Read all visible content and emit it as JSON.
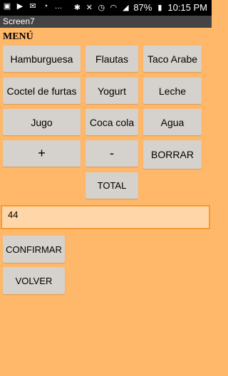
{
  "statusbar": {
    "battery": "87%",
    "time": "10:15 PM"
  },
  "app": {
    "title": "Screen7",
    "menu_label": "MENÚ"
  },
  "buttons": {
    "hamburguesa": "Hamburguesa",
    "flautas": "Flautas",
    "taco_arabe": "Taco Arabe",
    "coctel": "Coctel de furtas",
    "yogurt": "Yogurt",
    "leche": "Leche",
    "jugo": "Jugo",
    "coca": "Coca cola",
    "agua": "Agua",
    "plus": "+",
    "minus": "-",
    "borrar": "BORRAR",
    "total": "TOTAL",
    "confirmar": "CONFIRMAR",
    "volver": "VOLVER"
  },
  "total_field": {
    "value": "44"
  }
}
